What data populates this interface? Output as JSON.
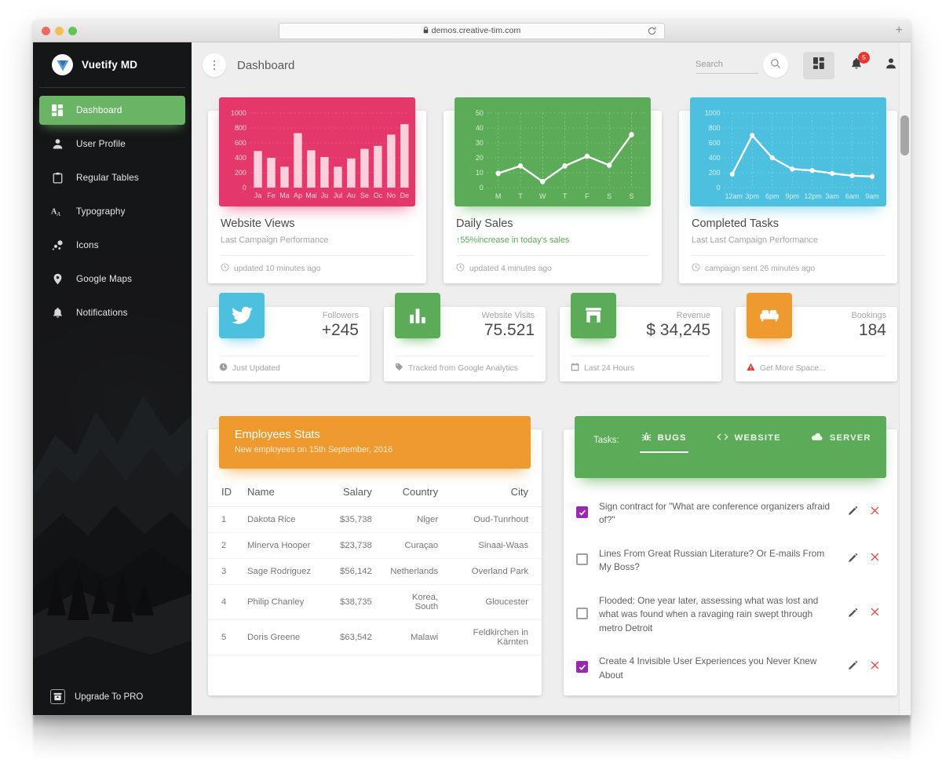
{
  "browser": {
    "url": "demos.creative-tim.com",
    "lock_icon": "lock-icon",
    "reload_icon": "reload-icon",
    "new_tab_label": "+"
  },
  "sidebar": {
    "brand": "Vuetify MD",
    "items": [
      {
        "label": "Dashboard",
        "icon": "dashboard-icon",
        "active": true
      },
      {
        "label": "User Profile",
        "icon": "person-icon",
        "active": false
      },
      {
        "label": "Regular Tables",
        "icon": "clipboard-icon",
        "active": false
      },
      {
        "label": "Typography",
        "icon": "typography-icon",
        "active": false
      },
      {
        "label": "Icons",
        "icon": "bubbles-icon",
        "active": false
      },
      {
        "label": "Google Maps",
        "icon": "map-pin-icon",
        "active": false
      },
      {
        "label": "Notifications",
        "icon": "bell-icon",
        "active": false
      }
    ],
    "upgrade_label": "Upgrade To PRO",
    "upgrade_icon": "unarchive-icon",
    "active_color": "#6ab465"
  },
  "header": {
    "menu_icon": "kebab-menu-icon",
    "title": "Dashboard",
    "search_placeholder": "Search",
    "search_value": "",
    "search_icon": "search-icon",
    "grid_icon": "apps-grid-icon",
    "bell_icon": "bell-icon",
    "notification_count": "5",
    "user_icon": "person-icon",
    "badge_color": "#e53935"
  },
  "chart_cards": [
    {
      "title": "Website Views",
      "subtitle": "Last Campaign Performance",
      "footer": "updated 10 minutes ago",
      "footer_icon": "clock-icon",
      "color": "#e5386a"
    },
    {
      "title": "Daily Sales",
      "subtitle_prefix": "↑",
      "subtitle": "55%increase in today's sales",
      "footer": "updated 4 minutes ago",
      "footer_icon": "clock-icon",
      "color": "#5cab58"
    },
    {
      "title": "Completed Tasks",
      "subtitle": "Last Last Campaign Performance",
      "footer": "campaign sent 26 minutes ago",
      "footer_icon": "clock-icon",
      "color": "#4dc0e0"
    }
  ],
  "chart_data": [
    {
      "type": "bar",
      "title": "Website Views",
      "categories": [
        "Ja",
        "Fe",
        "Ma",
        "Ap",
        "Mai",
        "Ju",
        "Jul",
        "Au",
        "Se",
        "Oc",
        "No",
        "De"
      ],
      "values": [
        490,
        400,
        280,
        730,
        500,
        410,
        280,
        390,
        520,
        560,
        710,
        850
      ],
      "ytick_labels": [
        "1000",
        "800",
        "600",
        "400",
        "200",
        "0"
      ],
      "yticks": [
        1000,
        800,
        600,
        400,
        200,
        0
      ],
      "ylim": [
        0,
        1000
      ],
      "xlabel": "",
      "ylabel": "",
      "grid": true,
      "legend": "none",
      "series_color": "#fbd0dc",
      "background": "#e5386a"
    },
    {
      "type": "line",
      "title": "Daily Sales",
      "categories": [
        "M",
        "T",
        "W",
        "T",
        "F",
        "S",
        "S"
      ],
      "values": [
        9.5,
        14.5,
        4,
        14.5,
        21,
        15,
        35.5
      ],
      "ytick_labels": [
        "50",
        "40",
        "30",
        "20",
        "10",
        "0"
      ],
      "yticks": [
        50,
        40,
        30,
        20,
        10,
        0
      ],
      "ylim": [
        0,
        50
      ],
      "xlabel": "",
      "ylabel": "",
      "grid": true,
      "legend": "none",
      "series_color": "#ffffff",
      "background": "#5cab58"
    },
    {
      "type": "line",
      "title": "Completed Tasks",
      "categories": [
        "12am",
        "3pm",
        "6pm",
        "9pm",
        "12pm",
        "3am",
        "6am",
        "9am"
      ],
      "values": [
        180,
        700,
        400,
        250,
        230,
        190,
        160,
        150
      ],
      "ytick_labels": [
        "1000",
        "800",
        "600",
        "400",
        "200",
        "0"
      ],
      "yticks": [
        1000,
        800,
        600,
        400,
        200,
        0
      ],
      "ylim": [
        0,
        1000
      ],
      "xlabel": "",
      "ylabel": "",
      "grid": true,
      "legend": "none",
      "series_color": "#ffffff",
      "background": "#4dc0e0"
    }
  ],
  "stat_cards": [
    {
      "icon": "twitter-icon",
      "icon_color": "#4dc0e0",
      "label": "Followers",
      "value": "+245",
      "footer": "Just Updated",
      "footer_icon": "clock-icon"
    },
    {
      "icon": "bar-chart-icon",
      "icon_color": "#5cab58",
      "label": "Website Visits",
      "value": "75.521",
      "footer": "Tracked from Google Analytics",
      "footer_icon": "tag-icon"
    },
    {
      "icon": "store-icon",
      "icon_color": "#5cab58",
      "label": "Revenue",
      "value": "$ 34,245",
      "footer": "Last 24 Hours",
      "footer_icon": "calendar-icon"
    },
    {
      "icon": "sofa-icon",
      "icon_color": "#ef9a2e",
      "label": "Bookings",
      "value": "184",
      "footer": "Get More Space...",
      "footer_icon": "warning-icon"
    }
  ],
  "employees": {
    "title": "Employees Stats",
    "subtitle": "New employees on 15th September, 2016",
    "columns": [
      "ID",
      "Name",
      "Salary",
      "Country",
      "City"
    ],
    "rows": [
      [
        "1",
        "Dakota Rice",
        "$35,738",
        "Niger",
        "Oud-Tunrhout"
      ],
      [
        "2",
        "Minerva Hooper",
        "$23,738",
        "Curaçao",
        "Sinaai-Waas"
      ],
      [
        "3",
        "Sage Rodriguez",
        "$56,142",
        "Netherlands",
        "Overland Park"
      ],
      [
        "4",
        "Philip Chanley",
        "$38,735",
        "Korea, South",
        "Gloucester"
      ],
      [
        "5",
        "Doris Greene",
        "$63,542",
        "Malawi",
        "Feldkirchen in Kärnten"
      ]
    ],
    "header_color": "#ef9a2e"
  },
  "tasks": {
    "label": "Tasks:",
    "tabs": [
      {
        "label": "BUGS",
        "icon": "bug-icon",
        "active": true
      },
      {
        "label": "WEBSITE",
        "icon": "code-icon",
        "active": false
      },
      {
        "label": "SERVER",
        "icon": "cloud-icon",
        "active": false
      }
    ],
    "header_color": "#5cab58",
    "checked_color": "#9c27b0",
    "items": [
      {
        "text": "Sign contract for \"What are conference organizers afraid of?\"",
        "checked": true,
        "edit_icon": "pencil-icon",
        "delete_icon": "close-icon"
      },
      {
        "text": "Lines From Great Russian Literature? Or E-mails From My Boss?",
        "checked": false,
        "edit_icon": "pencil-icon",
        "delete_icon": "close-icon"
      },
      {
        "text": "Flooded: One year later, assessing what was lost and what was found when a ravaging rain swept through metro Detroit",
        "checked": false,
        "edit_icon": "pencil-icon",
        "delete_icon": "close-icon"
      },
      {
        "text": "Create 4 Invisible User Experiences you Never Knew About",
        "checked": true,
        "edit_icon": "pencil-icon",
        "delete_icon": "close-icon"
      }
    ]
  }
}
